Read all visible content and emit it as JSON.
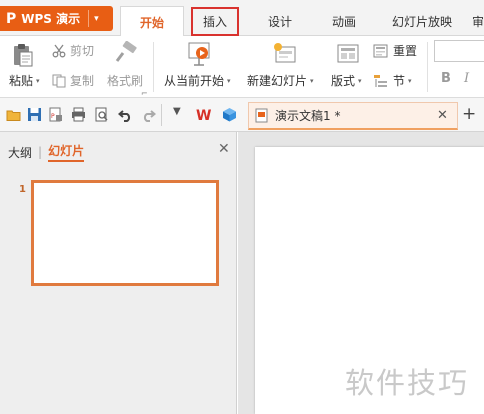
{
  "app": {
    "logo": "P",
    "name": "WPS 演示",
    "caret": "▾"
  },
  "tabs": [
    {
      "label": "开始"
    },
    {
      "label": "插入"
    },
    {
      "label": "设计"
    },
    {
      "label": "动画"
    },
    {
      "label": "幻灯片放映"
    },
    {
      "label": "审"
    }
  ],
  "ribbon": {
    "paste": "粘贴",
    "cut": "剪切",
    "copy": "复制",
    "format_painter": "格式刷",
    "from_current": "从当前开始",
    "new_slide": "新建幻灯片",
    "layout": "版式",
    "reset": "重置",
    "section": "节",
    "bold": "B",
    "italic": "I"
  },
  "doc_tab": {
    "title": "演示文稿1 *",
    "close": "✕"
  },
  "new_tab": "+",
  "left_panel": {
    "outline_tab": "大纲",
    "separator": "|",
    "slides_tab": "幻灯片",
    "close": "✕",
    "slide_number": "1"
  },
  "watermark": "软件技巧",
  "colors": {
    "accent": "#e85e14",
    "active_tab_text": "#e0652a",
    "highlight_box": "#d9322e"
  }
}
